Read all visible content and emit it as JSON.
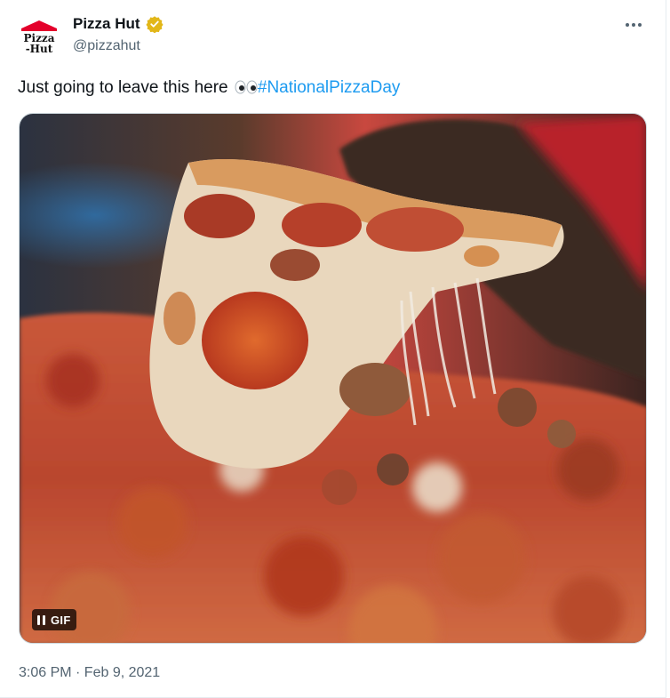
{
  "author": {
    "display_name": "Pizza Hut",
    "handle": "@pizzahut",
    "verified_badge_icon": "gold-verified-badge-icon",
    "avatar_logo_text_top": "Pizza",
    "avatar_logo_text_bottom": "Hut"
  },
  "tweet": {
    "text": "Just going to leave this here ",
    "emoji": "👀",
    "hashtag": "#NationalPizzaDay"
  },
  "media": {
    "type": "gif",
    "gif_label": "GIF",
    "pause_icon": "pause-icon"
  },
  "meta": {
    "timestamp": "3:06 PM · Feb 9, 2021"
  },
  "colors": {
    "hashtag": "#1d9bf0",
    "verified_gold": "#e2b719",
    "pizza_hut_red": "#e4002b"
  }
}
